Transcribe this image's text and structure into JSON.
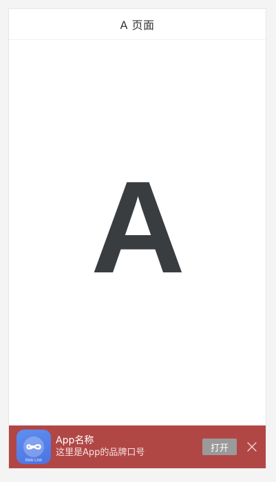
{
  "navbar": {
    "title": "A 页面"
  },
  "content": {
    "letter": "A"
  },
  "banner": {
    "app_name": "App名称",
    "slogan": "这里是App的品牌口号",
    "icon_caption": "Mob Link",
    "open_label": "打开",
    "icon": "infinity-icon",
    "close_icon": "close-icon",
    "background_color": "#b14745"
  }
}
